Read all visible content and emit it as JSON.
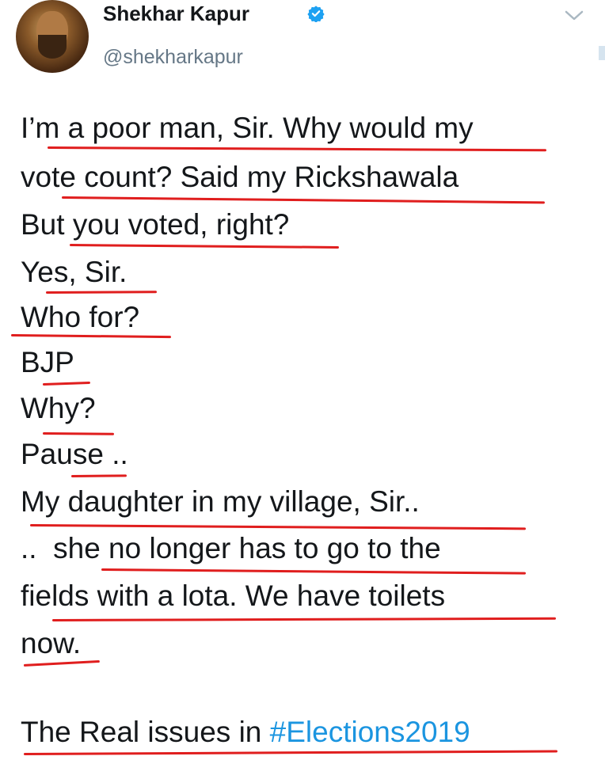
{
  "author": {
    "name": "Shekhar Kapur",
    "handle": "@shekharkapur",
    "verified": true
  },
  "tweet": {
    "lines": [
      "I’m a poor man, Sir. Why would my",
      "vote count? Said my Rickshawala",
      "But you voted, right?",
      "Yes, Sir.",
      "Who for?",
      "BJP",
      "Why?",
      "Pause ..",
      "My daughter in my village, Sir..",
      "..  she no longer has to go to the",
      "fields with a lota. We have toilets",
      "now."
    ],
    "closing_prefix": "The Real issues in ",
    "hashtag": "#Elections2019"
  },
  "colors": {
    "text": "#14171a",
    "handle": "#657786",
    "hashtag": "#1b95e0",
    "verified_badge": "#1da1f2",
    "underline_annotation": "#e01e1e"
  },
  "icons": [
    "verified-badge-icon",
    "chevron-down-icon"
  ]
}
